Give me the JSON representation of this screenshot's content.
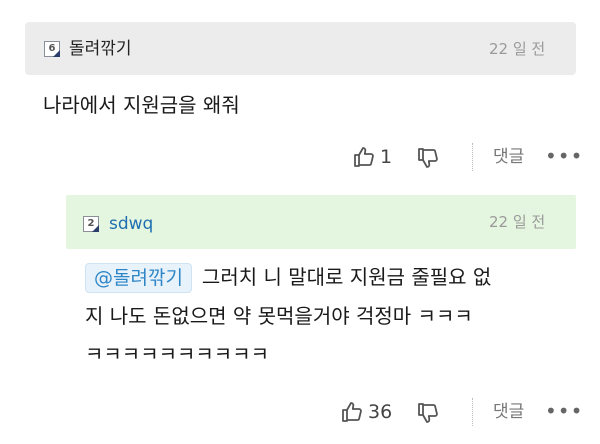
{
  "comment1": {
    "level": "6",
    "nickname": "돌려깎기",
    "time": "22 일 전",
    "text": "나라에서 지원금을 왜줘",
    "likes": "1",
    "reply_label": "댓글",
    "more": "•••"
  },
  "comment2": {
    "level": "2",
    "nickname": "sdwq",
    "time": "22 일 전",
    "mention": "@돌려깎기",
    "text_line1": "그러치 니 말대로 지원금 줄필요 없",
    "text_line2": "지 나도 돈없으면 약 못먹을거야 걱정마 ㅋㅋㅋ",
    "text_line3": "ㅋㅋㅋㅋㅋㅋㅋㅋㅋㅋ",
    "likes": "36",
    "reply_label": "댓글",
    "more": "•••"
  },
  "colors": {
    "header_gray": "#ececec",
    "header_green": "#e5f6e0",
    "mention_blue": "#2f86c7",
    "nick_blue": "#1f6fb0"
  }
}
